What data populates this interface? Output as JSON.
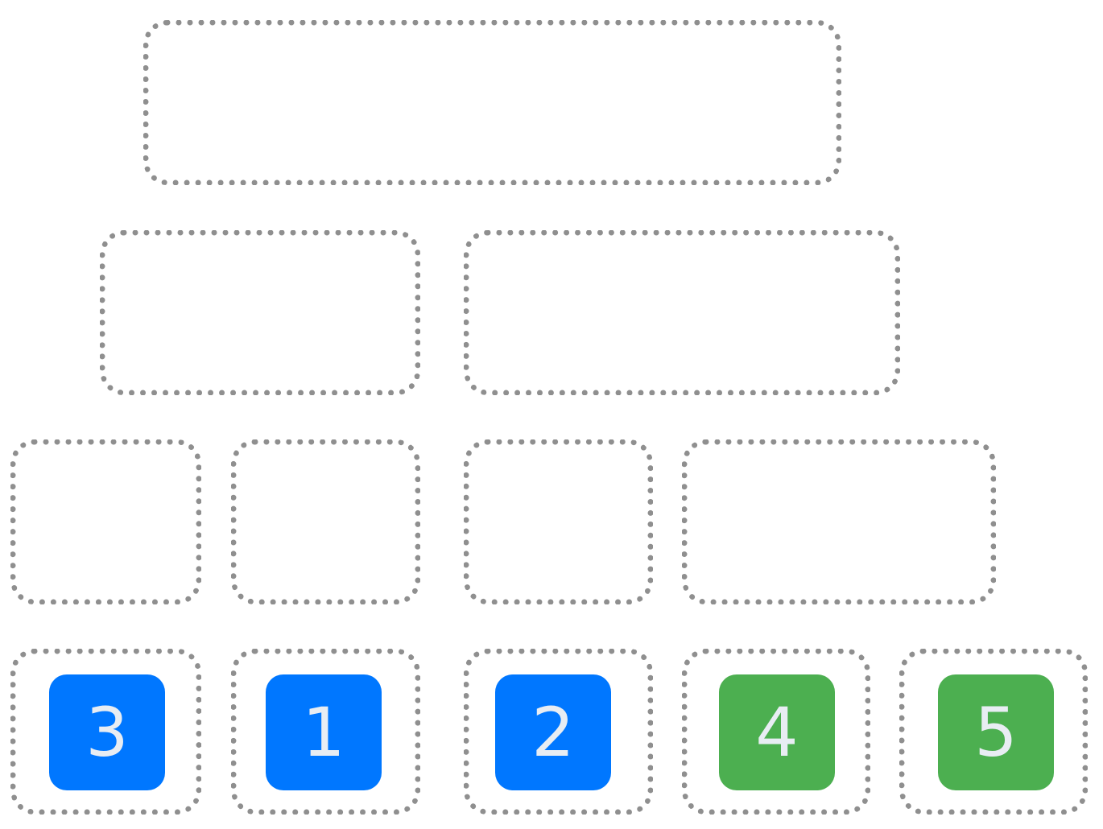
{
  "colors": {
    "slot_border": "#8f8f8f",
    "blue_tile": "#0077ff",
    "green_tile": "#4caf50",
    "tile_text": "#e8edf3",
    "background": "#ffffff"
  },
  "tiles": [
    {
      "label": "3",
      "color": "blue"
    },
    {
      "label": "1",
      "color": "blue"
    },
    {
      "label": "2",
      "color": "blue"
    },
    {
      "label": "4",
      "color": "green"
    },
    {
      "label": "5",
      "color": "green"
    }
  ]
}
